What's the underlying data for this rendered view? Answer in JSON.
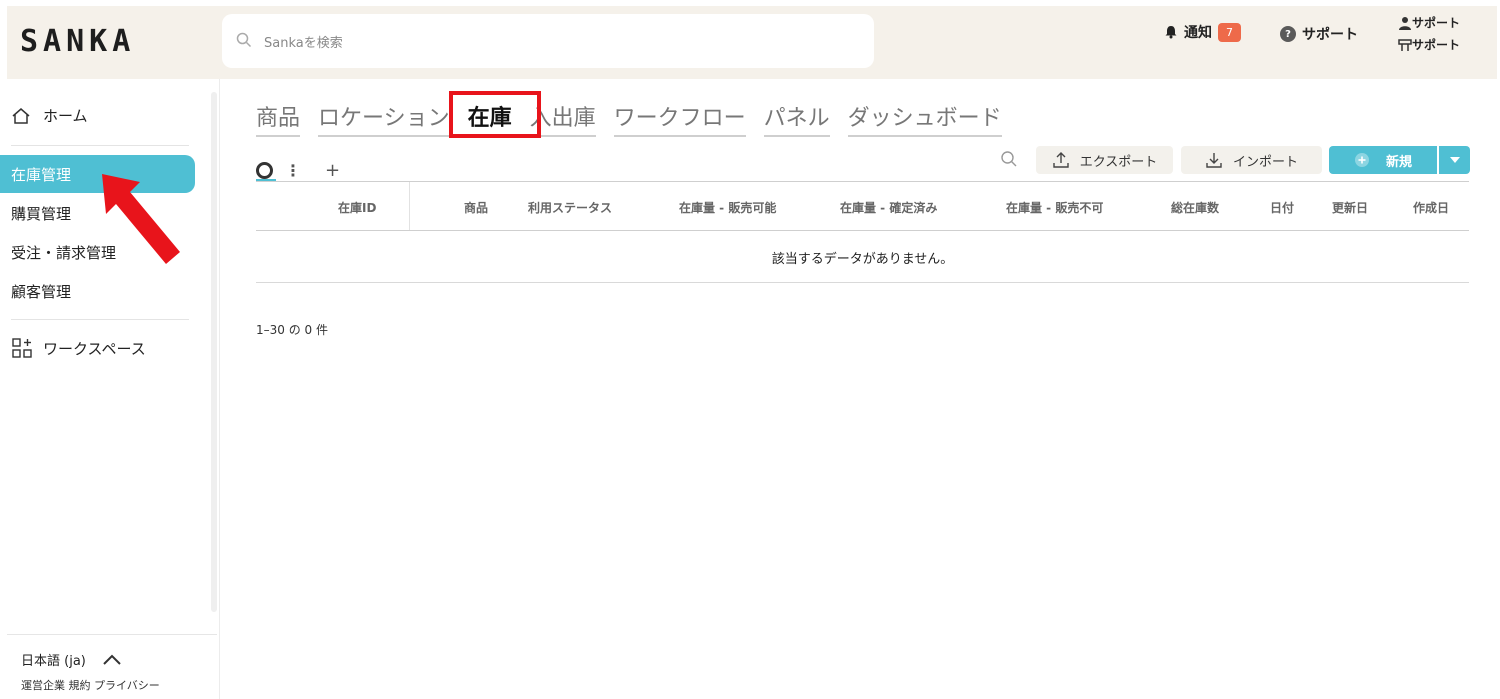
{
  "brand": {
    "logo": "SANKA"
  },
  "search": {
    "placeholder": "Sankaを検索"
  },
  "header": {
    "notifications_label": "通知",
    "notifications_count": "7",
    "support_label": "サポート",
    "user_name_1": "サポート",
    "user_name_2": "サポート"
  },
  "sidebar": {
    "home": "ホーム",
    "items": [
      {
        "label": "在庫管理",
        "active": true
      },
      {
        "label": "購買管理"
      },
      {
        "label": "受注・請求管理"
      },
      {
        "label": "顧客管理"
      }
    ],
    "workspace": "ワークスペース",
    "language": "日本語 (ja)",
    "footer_links": "運営企業 規約 プライバシー"
  },
  "tabs": [
    {
      "label": "商品"
    },
    {
      "label": "ロケーション"
    },
    {
      "label": "在庫",
      "current": true
    },
    {
      "label": "入出庫"
    },
    {
      "label": "ワークフロー"
    },
    {
      "label": "パネル"
    },
    {
      "label": "ダッシュボード"
    }
  ],
  "toolbar": {
    "export_label": "エクスポート",
    "import_label": "インポート",
    "new_label": "新規"
  },
  "table": {
    "columns": [
      "在庫ID",
      "商品",
      "利用ステータス",
      "在庫量 - 販売可能",
      "在庫量 - 確定済み",
      "在庫量 - 販売不可",
      "総在庫数",
      "日付",
      "更新日",
      "作成日"
    ],
    "empty_message": "該当するデータがありません。"
  },
  "pagination": {
    "summary": "1–30 の 0 件"
  },
  "colors": {
    "accent": "#4fbfd3",
    "annotation": "#e8141b",
    "badge": "#ee6a4a"
  }
}
